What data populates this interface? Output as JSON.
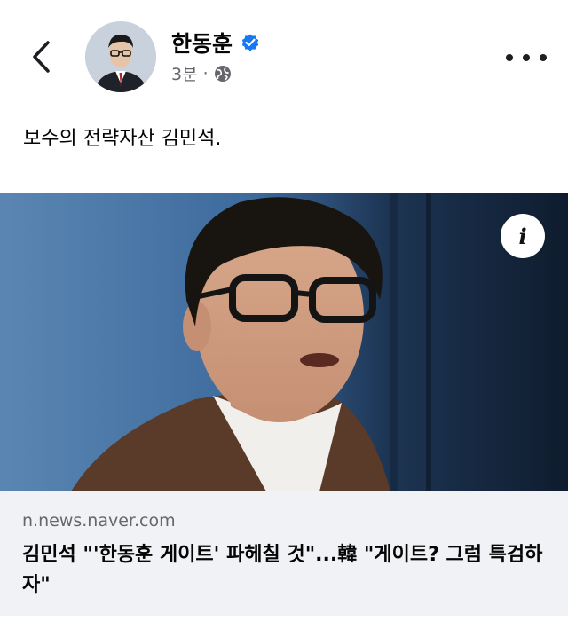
{
  "header": {
    "author_name": "한동훈",
    "time": "3분",
    "separator": "·",
    "icons": {
      "back": "chevron-left-icon",
      "verified": "verified-badge-icon",
      "privacy": "globe-icon",
      "more": "more-icon"
    },
    "verified_color": "#1877f2"
  },
  "post": {
    "text": "보수의 전략자산 김민석."
  },
  "link_preview": {
    "domain": "n.news.naver.com",
    "headline": "김민석 \"'한동훈 게이트' 파헤칠 것\"...韓 \"게이트? 그럼 특검하자\"",
    "info_icon": "info-icon",
    "info_glyph": "i"
  }
}
